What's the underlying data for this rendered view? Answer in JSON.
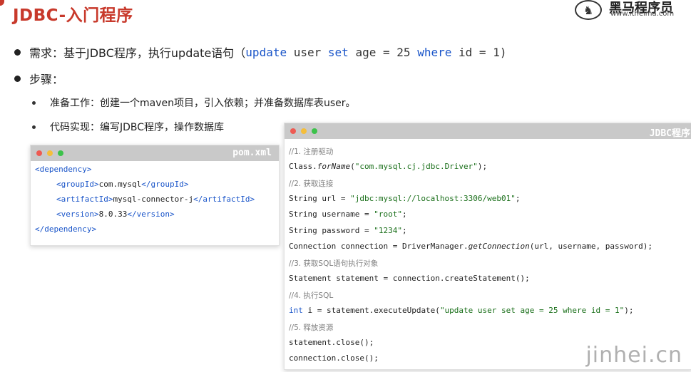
{
  "header": {
    "title": "JDBC-入门程序",
    "logo_name": "黑马程序员",
    "logo_url": "www.itheima.com"
  },
  "bullets": {
    "need_label": "需求：基于JDBC程序，执行update语句（",
    "need_code": [
      "update",
      "user",
      "set",
      "age",
      "=",
      "25",
      "where",
      "id",
      "=",
      "1)"
    ],
    "steps_label": "步骤：",
    "step1": "准备工作：创建一个maven项目，引入依赖；并准备数据库表user。",
    "step2": "代码实现：编写JDBC程序，操作数据库"
  },
  "pom": {
    "title": "pom.xml",
    "lines": [
      {
        "open": "<dependency>"
      },
      {
        "tag_open": "<groupId>",
        "text": "com.mysql",
        "tag_close": "</groupId>"
      },
      {
        "tag_open": "<artifactId>",
        "text": "mysql-connector-j",
        "tag_close": "</artifactId>"
      },
      {
        "tag_open": "<version>",
        "text": "8.0.33",
        "tag_close": "</version>"
      },
      {
        "open": "</dependency>"
      }
    ]
  },
  "jdbc": {
    "title": "JDBC程序",
    "c1": "//1. 注册驱动",
    "l1a": "Class.",
    "l1b": "forName",
    "l1c": "(",
    "l1d": "\"com.mysql.cj.jdbc.Driver\"",
    "l1e": ");",
    "c2": "//2. 获取连接",
    "l2a": "String url = ",
    "l2b": "\"jdbc:mysql://localhost:3306/web01\"",
    "l2c": ";",
    "l3a": "String username = ",
    "l3b": "\"root\"",
    "l3c": ";",
    "l4a": "String password = ",
    "l4b": "\"1234\"",
    "l4c": ";",
    "l5a": "Connection connection = DriverManager.",
    "l5b": "getConnection",
    "l5c": "(url, username, password);",
    "c3": "//3. 获取SQL语句执行对象",
    "l6": "Statement statement = connection.createStatement();",
    "c4": "//4. 执行SQL",
    "l7a": "int",
    "l7b": " i = statement.executeUpdate(",
    "l7c": "\"update user set age = 25 where id = 1\"",
    "l7d": ");",
    "c5": "//5. 释放资源",
    "l8": "statement.close();",
    "l9": "connection.close();"
  },
  "watermark": "jinhei.cn"
}
